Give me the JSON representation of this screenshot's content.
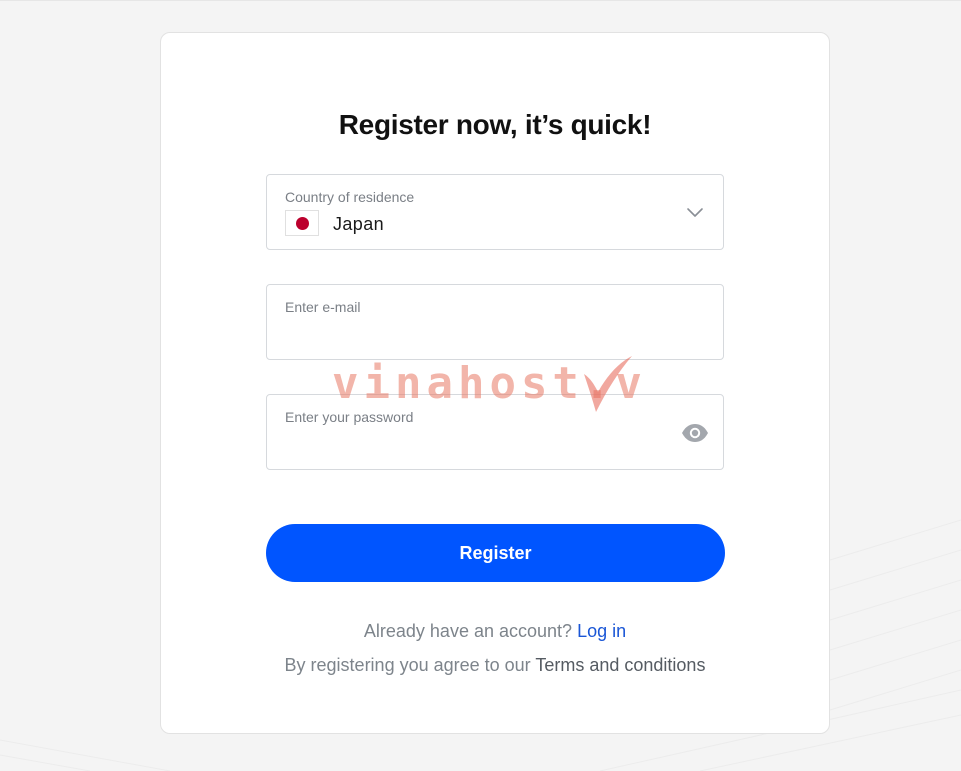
{
  "form": {
    "title": "Register now, it’s quick!",
    "country": {
      "label": "Country of residence",
      "value": "Japan",
      "flag_icon": "japan-flag-icon",
      "dropdown_icon": "chevron-down-icon"
    },
    "email": {
      "label": "Enter e-mail",
      "value": ""
    },
    "password": {
      "label": "Enter your password",
      "value": "",
      "toggle_icon": "eye-icon"
    },
    "register_label": "Register",
    "login_prompt": "Already have an account?",
    "login_link": "Log in",
    "terms_prompt": "By registering you agree to our",
    "terms_link": "Terms and conditions"
  },
  "watermark": {
    "text": "vinahost.v"
  },
  "colors": {
    "primary": "#0055ff",
    "link": "#1a56d6",
    "muted_text": "#7d848b",
    "flag_red": "#bc002d",
    "background": "#f4f4f4",
    "card": "#ffffff"
  }
}
